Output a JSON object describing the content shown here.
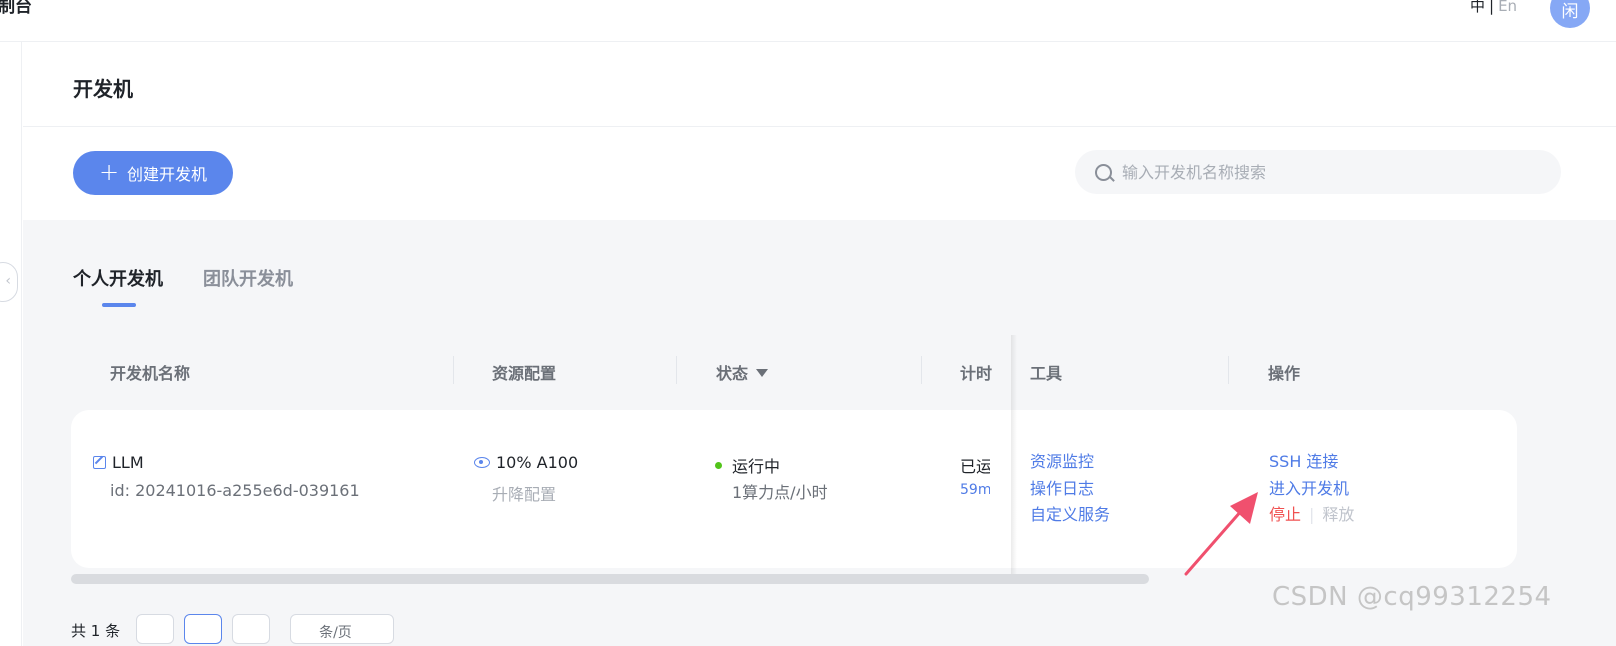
{
  "header": {
    "brand": "制台",
    "lang_zh": "中",
    "lang_sep": "|",
    "lang_en": "En",
    "avatar_text": "闲"
  },
  "page": {
    "title": "开发机"
  },
  "toolbar": {
    "create_label": "创建开发机",
    "search_placeholder": "输入开发机名称搜索"
  },
  "tabs": [
    {
      "label": "个人开发机",
      "active": true
    },
    {
      "label": "团队开发机",
      "active": false
    }
  ],
  "table": {
    "columns": [
      "开发机名称",
      "资源配置",
      "状态",
      "计时",
      "工具",
      "操作"
    ],
    "rows": [
      {
        "name": "LLM",
        "id": "id: 20241016-a255e6d-039161",
        "resource": "10% A100",
        "resource_action": "升降配置",
        "status": "运行中",
        "status_sub": "1算力点/小时",
        "timer_main": "已运",
        "timer_sub": "59m",
        "tools": [
          "资源监控",
          "操作日志",
          "自定义服务"
        ],
        "actions": {
          "ssh": "SSH 连接",
          "enter": "进入开发机",
          "stop": "停止",
          "sep": "|",
          "release": "释放"
        }
      }
    ]
  },
  "pager": {
    "total": "共 1 条",
    "size_label": "条/页"
  },
  "watermark": "CSDN @cq99312254",
  "colors": {
    "accent": "#5b86ec",
    "link": "#4f7be6",
    "running": "#52c41a",
    "danger": "#f05050",
    "annotation_arrow": "#f0506e"
  }
}
